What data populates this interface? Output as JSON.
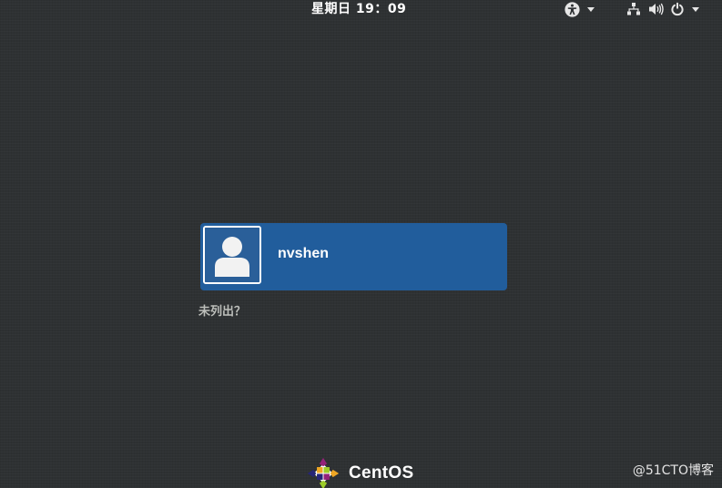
{
  "top_bar": {
    "clock": "星期日 19：09",
    "accessibility_icon": "accessibility-icon",
    "network_icon": "network-wired-icon",
    "volume_icon": "volume-icon",
    "power_icon": "power-icon",
    "menu_arrow_icon": "pan-down-icon"
  },
  "login": {
    "users": [
      {
        "name": "nvshen",
        "avatar_icon": "default-user-avatar-icon"
      }
    ],
    "not_listed_label": "未列出？"
  },
  "branding": {
    "logo_text": "CentOS",
    "logo_icon": "centos-emblem-icon"
  },
  "watermark": "@51CTO博客",
  "colors": {
    "background": "#2e3133",
    "user_selected": "#215d9c",
    "text": "#ffffff",
    "muted_text": "#bdbfbb"
  }
}
